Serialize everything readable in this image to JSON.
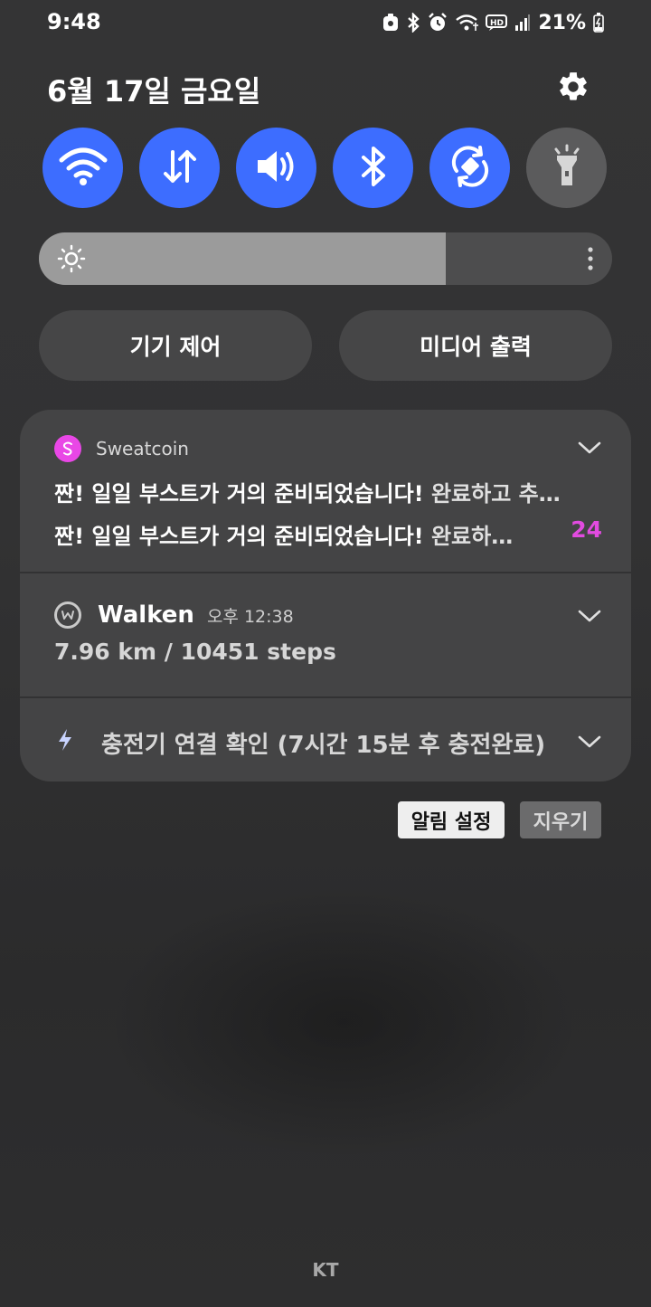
{
  "status_bar": {
    "time": "9:48",
    "battery": "21%",
    "icons": [
      "app-icon",
      "bluetooth-icon",
      "alarm-icon",
      "wifi-icon",
      "hd-voice-icon",
      "signal-icon",
      "battery-charging-icon"
    ]
  },
  "header": {
    "date": "6월 17일 금요일",
    "settings_icon": "gear-icon"
  },
  "quick_toggles": [
    {
      "name": "wifi",
      "icon": "wifi-icon",
      "state": "on"
    },
    {
      "name": "mobile-data",
      "icon": "data-arrows-icon",
      "state": "on"
    },
    {
      "name": "sound",
      "icon": "speaker-icon",
      "state": "on"
    },
    {
      "name": "bluetooth",
      "icon": "bluetooth-icon",
      "state": "on"
    },
    {
      "name": "auto-rotate",
      "icon": "rotate-icon",
      "state": "on"
    },
    {
      "name": "flashlight",
      "icon": "flashlight-icon",
      "state": "off"
    }
  ],
  "brightness": {
    "level": 0.71
  },
  "buttons": {
    "device_control": "기기 제어",
    "media_output": "미디어 출력"
  },
  "notifications": {
    "sweatcoin": {
      "app": "Sweatcoin",
      "line1": "짠! 일일 부스트가 거의 준비되었습니다!",
      "line1_rest": " 완료하고 추…",
      "line2": "짠! 일일 부스트가 거의 준비되었습니다!",
      "line2_rest": " 완료하…",
      "count": "24"
    },
    "walken": {
      "app": "Walken",
      "time": "오후 12:38",
      "body": "7.96 km / 10451 steps"
    },
    "charging": {
      "text": "충전기 연결 확인 (7시간 15분 후 충전완료)"
    }
  },
  "actions": {
    "notification_settings": "알림 설정",
    "clear": "지우기"
  },
  "carrier": "KT",
  "colors": {
    "accent": "#3d6dff",
    "sweatcoin": "#e947e6"
  }
}
